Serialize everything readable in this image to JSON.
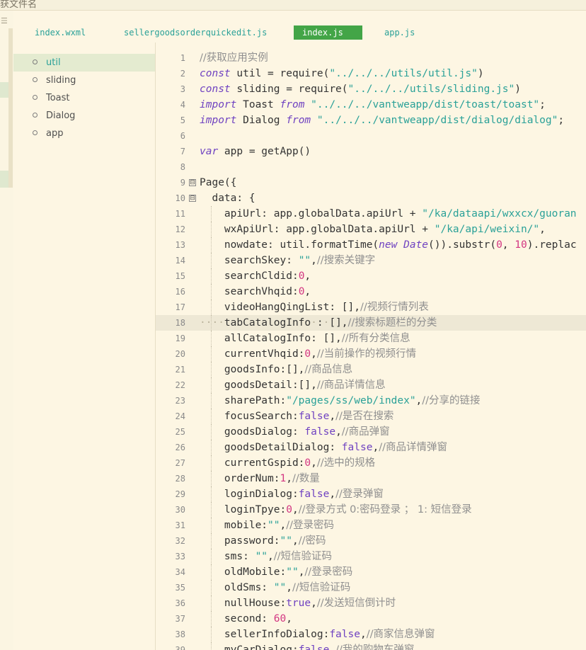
{
  "window": {
    "title": "获文件名"
  },
  "tabs": [
    {
      "label": "index.wxml",
      "active": false
    },
    {
      "label": "sellergoodsorderquickedit.js",
      "active": false
    },
    {
      "label": "index.js",
      "active": true
    },
    {
      "label": "app.js",
      "active": false
    }
  ],
  "outline": {
    "items": [
      {
        "label": "util",
        "selected": true
      },
      {
        "label": "sliding",
        "selected": false
      },
      {
        "label": "Toast",
        "selected": false
      },
      {
        "label": "Dialog",
        "selected": false
      },
      {
        "label": "app",
        "selected": false
      }
    ]
  },
  "editor": {
    "highlighted_line": 18,
    "lines": [
      {
        "n": "1",
        "tokens": [
          [
            "cm",
            "//获取应用实例"
          ]
        ]
      },
      {
        "n": "2",
        "tokens": [
          [
            "kw",
            "const"
          ],
          [
            "fn",
            " util = require("
          ],
          [
            "str",
            "\"../../../utils/util.js\""
          ],
          [
            "fn",
            ")"
          ]
        ]
      },
      {
        "n": "3",
        "tokens": [
          [
            "kw",
            "const"
          ],
          [
            "fn",
            " sliding = require("
          ],
          [
            "str",
            "\"../../../utils/sliding.js\""
          ],
          [
            "fn",
            ")"
          ]
        ]
      },
      {
        "n": "4",
        "tokens": [
          [
            "kw",
            "import"
          ],
          [
            "fn",
            " Toast "
          ],
          [
            "kw",
            "from"
          ],
          [
            "fn",
            " "
          ],
          [
            "str",
            "\"../../../vantweapp/dist/toast/toast\""
          ],
          [
            "fn",
            ";"
          ]
        ]
      },
      {
        "n": "5",
        "tokens": [
          [
            "kw",
            "import"
          ],
          [
            "fn",
            " Dialog "
          ],
          [
            "kw",
            "from"
          ],
          [
            "fn",
            " "
          ],
          [
            "str",
            "\"../../../vantweapp/dist/dialog/dialog\""
          ],
          [
            "fn",
            ";"
          ]
        ]
      },
      {
        "n": "6",
        "tokens": []
      },
      {
        "n": "7",
        "tokens": [
          [
            "kw",
            "var"
          ],
          [
            "fn",
            " app = getApp()"
          ]
        ]
      },
      {
        "n": "8",
        "tokens": []
      },
      {
        "n": "9",
        "fold": "⊟",
        "tokens": [
          [
            "fn",
            "Page({"
          ]
        ]
      },
      {
        "n": "10",
        "fold": "⊟",
        "tokens": [
          [
            "fn",
            "  data: {"
          ]
        ]
      },
      {
        "n": "11",
        "tokens": [
          [
            "fn",
            "    apiUrl: app.globalData.apiUrl + "
          ],
          [
            "str",
            "\"/ka/dataapi/wxxcx/guoran"
          ]
        ]
      },
      {
        "n": "12",
        "tokens": [
          [
            "fn",
            "    wxApiUrl: app.globalData.apiUrl + "
          ],
          [
            "str",
            "\"/ka/api/weixin/\""
          ],
          [
            "fn",
            ","
          ]
        ]
      },
      {
        "n": "13",
        "tokens": [
          [
            "fn",
            "    nowdate: util.formatTime("
          ],
          [
            "kw",
            "new"
          ],
          [
            "fn",
            " "
          ],
          [
            "kw",
            "Date"
          ],
          [
            "fn",
            "()).substr("
          ],
          [
            "num",
            "0"
          ],
          [
            "fn",
            ", "
          ],
          [
            "num",
            "10"
          ],
          [
            "fn",
            ").replac"
          ]
        ]
      },
      {
        "n": "14",
        "tokens": [
          [
            "fn",
            "    searchSkey: "
          ],
          [
            "str",
            "\"\""
          ],
          [
            "fn",
            ","
          ],
          [
            "cm",
            "//搜索关键字"
          ]
        ]
      },
      {
        "n": "15",
        "tokens": [
          [
            "fn",
            "    searchCldid:"
          ],
          [
            "num",
            "0"
          ],
          [
            "fn",
            ","
          ]
        ]
      },
      {
        "n": "16",
        "tokens": [
          [
            "fn",
            "    searchVhqid:"
          ],
          [
            "num",
            "0"
          ],
          [
            "fn",
            ","
          ]
        ]
      },
      {
        "n": "17",
        "tokens": [
          [
            "fn",
            "    videoHangQingList: [],"
          ],
          [
            "cm",
            "//视频行情列表"
          ]
        ]
      },
      {
        "n": "18",
        "tokens": [
          [
            "ws",
            "····"
          ],
          [
            "fn",
            "tabCatalogInfo"
          ],
          [
            "ws",
            "·"
          ],
          [
            "fn",
            ":"
          ],
          [
            "ws",
            "·"
          ],
          [
            "fn",
            "[],"
          ],
          [
            "cm",
            "//搜索标题栏的分类"
          ]
        ]
      },
      {
        "n": "19",
        "tokens": [
          [
            "fn",
            "    allCatalogInfo: [],"
          ],
          [
            "cm",
            "//所有分类信息"
          ]
        ]
      },
      {
        "n": "20",
        "tokens": [
          [
            "fn",
            "    currentVhqid:"
          ],
          [
            "num",
            "0"
          ],
          [
            "fn",
            ","
          ],
          [
            "cm",
            "//当前操作的视频行情"
          ]
        ]
      },
      {
        "n": "21",
        "tokens": [
          [
            "fn",
            "    goodsInfo:[],"
          ],
          [
            "cm",
            "//商品信息"
          ]
        ]
      },
      {
        "n": "22",
        "tokens": [
          [
            "fn",
            "    goodsDetail:[],"
          ],
          [
            "cm",
            "//商品详情信息"
          ]
        ]
      },
      {
        "n": "23",
        "tokens": [
          [
            "fn",
            "    sharePath:"
          ],
          [
            "str",
            "\"/pages/ss/web/index\""
          ],
          [
            "fn",
            ","
          ],
          [
            "cm",
            "//分享的链接"
          ]
        ]
      },
      {
        "n": "24",
        "tokens": [
          [
            "fn",
            "    focusSearch:"
          ],
          [
            "bool",
            "false"
          ],
          [
            "fn",
            ","
          ],
          [
            "cm",
            "//是否在搜索"
          ]
        ]
      },
      {
        "n": "25",
        "tokens": [
          [
            "fn",
            "    goodsDialog: "
          ],
          [
            "bool",
            "false"
          ],
          [
            "fn",
            ","
          ],
          [
            "cm",
            "//商品弹窗"
          ]
        ]
      },
      {
        "n": "26",
        "tokens": [
          [
            "fn",
            "    goodsDetailDialog: "
          ],
          [
            "bool",
            "false"
          ],
          [
            "fn",
            ","
          ],
          [
            "cm",
            "//商品详情弹窗"
          ]
        ]
      },
      {
        "n": "27",
        "tokens": [
          [
            "fn",
            "    currentGspid:"
          ],
          [
            "num",
            "0"
          ],
          [
            "fn",
            ","
          ],
          [
            "cm",
            "//选中的规格"
          ]
        ]
      },
      {
        "n": "28",
        "tokens": [
          [
            "fn",
            "    orderNum:"
          ],
          [
            "num",
            "1"
          ],
          [
            "fn",
            ","
          ],
          [
            "cm",
            "//数量"
          ]
        ]
      },
      {
        "n": "29",
        "tokens": [
          [
            "fn",
            "    loginDialog:"
          ],
          [
            "bool",
            "false"
          ],
          [
            "fn",
            ","
          ],
          [
            "cm",
            "//登录弹窗"
          ]
        ]
      },
      {
        "n": "30",
        "tokens": [
          [
            "fn",
            "    loginTpye:"
          ],
          [
            "num",
            "0"
          ],
          [
            "fn",
            ","
          ],
          [
            "cm",
            "//登录方式 0:密码登录 ； 1: 短信登录"
          ]
        ]
      },
      {
        "n": "31",
        "tokens": [
          [
            "fn",
            "    mobile:"
          ],
          [
            "str",
            "\"\""
          ],
          [
            "fn",
            ","
          ],
          [
            "cm",
            "//登录密码"
          ]
        ]
      },
      {
        "n": "32",
        "tokens": [
          [
            "fn",
            "    password:"
          ],
          [
            "str",
            "\"\""
          ],
          [
            "fn",
            ","
          ],
          [
            "cm",
            "//密码"
          ]
        ]
      },
      {
        "n": "33",
        "tokens": [
          [
            "fn",
            "    sms: "
          ],
          [
            "str",
            "\"\""
          ],
          [
            "fn",
            ","
          ],
          [
            "cm",
            "//短信验证码"
          ]
        ]
      },
      {
        "n": "34",
        "tokens": [
          [
            "fn",
            "    oldMobile:"
          ],
          [
            "str",
            "\"\""
          ],
          [
            "fn",
            ","
          ],
          [
            "cm",
            "//登录密码"
          ]
        ]
      },
      {
        "n": "35",
        "tokens": [
          [
            "fn",
            "    oldSms: "
          ],
          [
            "str",
            "\"\""
          ],
          [
            "fn",
            ","
          ],
          [
            "cm",
            "//短信验证码"
          ]
        ]
      },
      {
        "n": "36",
        "tokens": [
          [
            "fn",
            "    nullHouse:"
          ],
          [
            "bool",
            "true"
          ],
          [
            "fn",
            ","
          ],
          [
            "cm",
            "//发送短信倒计时"
          ]
        ]
      },
      {
        "n": "37",
        "tokens": [
          [
            "fn",
            "    second: "
          ],
          [
            "num",
            "60"
          ],
          [
            "fn",
            ","
          ]
        ]
      },
      {
        "n": "38",
        "tokens": [
          [
            "fn",
            "    sellerInfoDialog:"
          ],
          [
            "bool",
            "false"
          ],
          [
            "fn",
            ","
          ],
          [
            "cm",
            "//商家信息弹窗"
          ]
        ]
      },
      {
        "n": "39",
        "tokens": [
          [
            "fn",
            "    myCarDialog:"
          ],
          [
            "bool",
            "false"
          ],
          [
            "fn",
            ","
          ],
          [
            "cm",
            "//我的购物车弹窗"
          ]
        ]
      }
    ]
  }
}
